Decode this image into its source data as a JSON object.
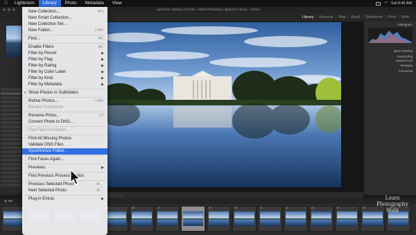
{
  "menubar": {
    "items": [
      "Lightroom",
      "Library",
      "Photo",
      "Metadata",
      "View"
    ],
    "open_index": 1,
    "clock": "Sat 8:46 AM"
  },
  "window": {
    "title": "Lightroom Catalog-v10.lrcat - Adobe Photoshop Lightroom Classic - Library"
  },
  "modules": {
    "items": [
      "Library",
      "Develop",
      "Map",
      "Book",
      "Slideshow",
      "Print",
      "Web"
    ],
    "active": "Library"
  },
  "right_panel": {
    "histogram_label": "Histogram",
    "rows": [
      "Quick Develop",
      "Keywording",
      "Keyword List",
      "Metadata",
      "Comments"
    ]
  },
  "library_menu": {
    "items": [
      {
        "label": "New Collection...",
        "shortcut": "⌘N"
      },
      {
        "label": "New Smart Collection..."
      },
      {
        "label": "New Collection Set..."
      },
      {
        "label": "New Folder...",
        "shortcut": "⇧⌘N"
      },
      {
        "sep": true
      },
      {
        "label": "Find...",
        "shortcut": "⌘F"
      },
      {
        "sep": true
      },
      {
        "label": "Enable Filters",
        "shortcut": "⌘L"
      },
      {
        "label": "Filter by Preset",
        "submenu": true
      },
      {
        "label": "Filter by Flag",
        "submenu": true
      },
      {
        "label": "Filter by Rating",
        "submenu": true
      },
      {
        "label": "Filter by Color Label",
        "submenu": true
      },
      {
        "label": "Filter by Kind",
        "submenu": true
      },
      {
        "label": "Filter by Metadata",
        "submenu": true
      },
      {
        "sep": true
      },
      {
        "label": "Show Photos in Subfolders",
        "checked": true
      },
      {
        "sep": true
      },
      {
        "label": "Refine Photos...",
        "shortcut": "⌥⌘R"
      },
      {
        "label": "Review Comments",
        "disabled": true
      },
      {
        "sep": true
      },
      {
        "label": "Rename Photo...",
        "shortcut": "F2"
      },
      {
        "label": "Convert Photo to DNG..."
      },
      {
        "sep": true
      },
      {
        "label": "Flat-Field Correction...",
        "disabled": true
      },
      {
        "sep": true
      },
      {
        "label": "Find All Missing Photos"
      },
      {
        "label": "Validate DNG Files"
      },
      {
        "label": "Synchronize Folder...",
        "highlighted": true
      },
      {
        "sep": true
      },
      {
        "label": "Find Faces Again..."
      },
      {
        "sep": true
      },
      {
        "label": "Previews",
        "submenu": true
      },
      {
        "sep": true
      },
      {
        "label": "Find Previous Process Photos"
      },
      {
        "sep": true
      },
      {
        "label": "Previous Selected Photo",
        "shortcut": "⌘←"
      },
      {
        "label": "Next Selected Photo",
        "shortcut": "⌘→"
      },
      {
        "sep": true
      },
      {
        "label": "Plug-in Extras",
        "submenu": true
      }
    ]
  },
  "filmstrip": {
    "numbers": [
      "",
      "",
      "53",
      "54",
      "55",
      "56",
      "57",
      "58",
      "59",
      "60",
      "61",
      "62",
      "63",
      "64",
      "65",
      ""
    ],
    "selected_index": 7
  },
  "watermark": {
    "lines": [
      "Learn",
      "Photography",
      "Walk"
    ]
  },
  "colors": {
    "menu_highlight": "#2f6fe0",
    "menu_bg": "#ececee"
  }
}
